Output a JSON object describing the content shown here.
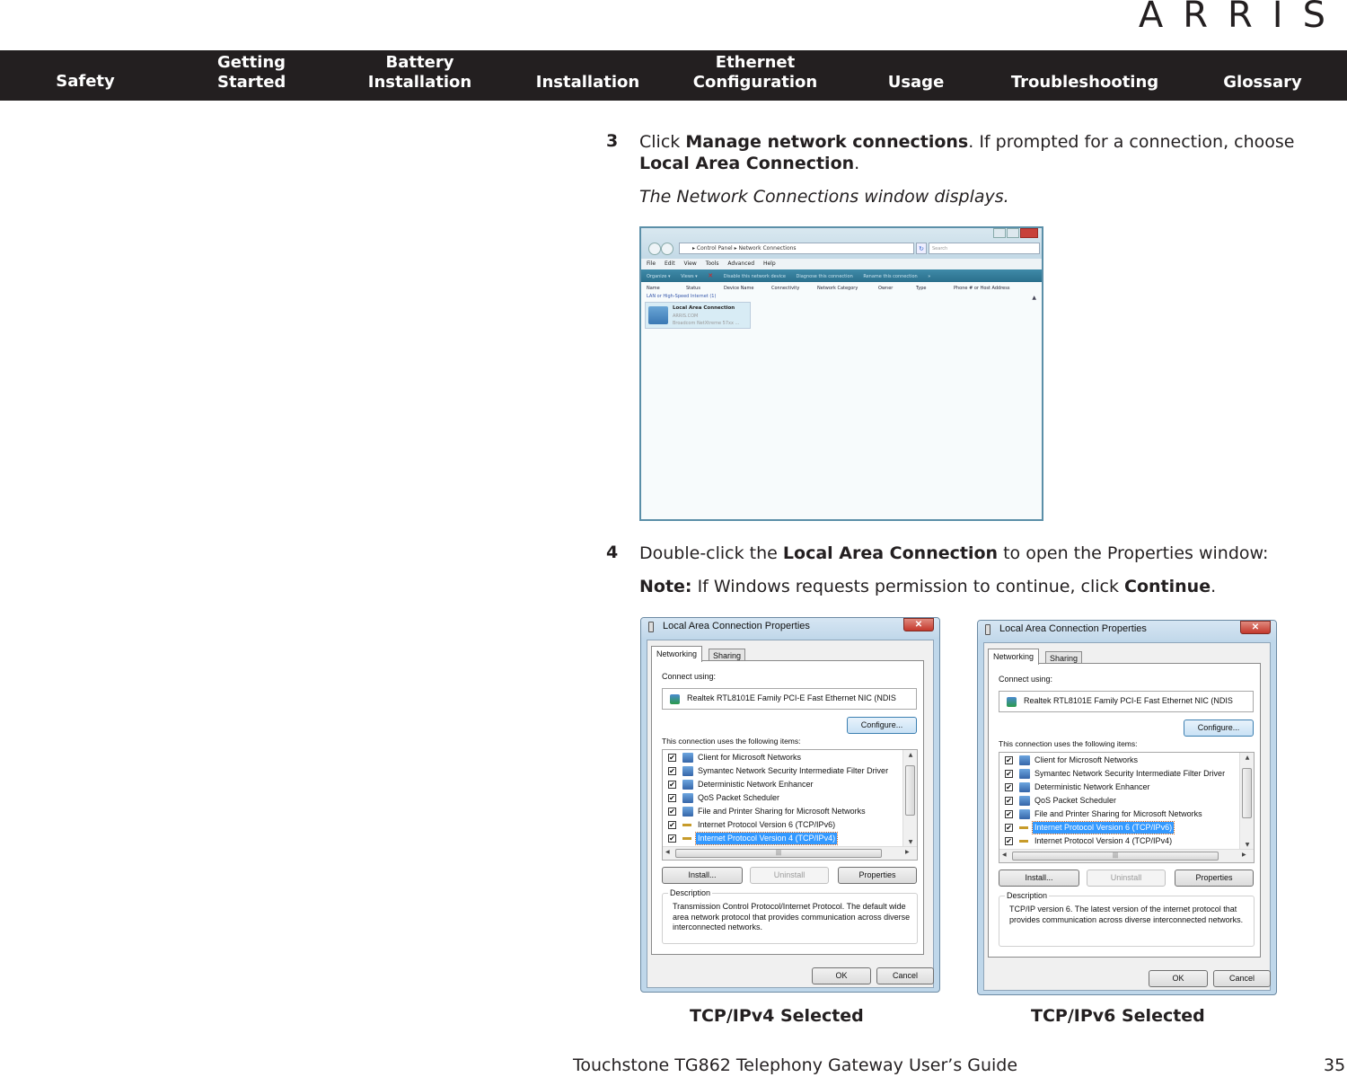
{
  "brand": {
    "logo_text": "ARRIS"
  },
  "nav": {
    "items": [
      {
        "label_line1": "",
        "label_line2": "Safety"
      },
      {
        "label_line1": "Getting",
        "label_line2": "Started"
      },
      {
        "label_line1": "Battery",
        "label_line2": "Installation"
      },
      {
        "label_line1": "",
        "label_line2": "Installation"
      },
      {
        "label_line1": "Ethernet",
        "label_line2": "Configuration"
      },
      {
        "label_line1": "",
        "label_line2": "Usage"
      },
      {
        "label_line1": "",
        "label_line2": "Troubleshooting"
      },
      {
        "label_line1": "",
        "label_line2": "Glossary"
      }
    ]
  },
  "steps": {
    "step3": {
      "number": "3",
      "text_1": "Click ",
      "bold_1": "Manage network connections",
      "text_2": ". If prompted for a connection, choose",
      "bold_2": "Local Area Connection",
      "text_3": ".",
      "result": "The Network Connections window displays."
    },
    "step4": {
      "number": "4",
      "text_1": "Double-click the ",
      "bold_1": "Local Area Connection",
      "text_2": " to open the Properties window:",
      "note_label": "Note:",
      "note_text": " If Windows requests permission to continue, click ",
      "note_bold": "Continue",
      "note_end": "."
    }
  },
  "network_connections_window": {
    "address_path": "▸ Control Panel ▸ Network Connections",
    "search_placeholder": "Search",
    "menu": [
      "File",
      "Edit",
      "View",
      "Tools",
      "Advanced",
      "Help"
    ],
    "toolbar": [
      "Organize ▾",
      "Views ▾",
      "Disable this network device",
      "Diagnose this connection",
      "Rename this connection",
      "»"
    ],
    "columns": [
      "Name",
      "Status",
      "Device Name",
      "Connectivity",
      "Network Category",
      "Owner",
      "Type",
      "Phone # or Host Address"
    ],
    "group_label": "LAN or High-Speed Internet (1)",
    "connection": {
      "name": "Local Area Connection",
      "network": "ARRIS.COM",
      "device": "Broadcom NetXtreme 57xx ..."
    }
  },
  "properties_dialogs": [
    {
      "title": "Local Area Connection Properties",
      "close_label": "✕",
      "tabs": [
        "Networking",
        "Sharing"
      ],
      "connect_using_label": "Connect using:",
      "adapter": "Realtek RTL8101E Family PCI-E Fast Ethernet NIC (NDIS",
      "configure_label": "Configure...",
      "items_label": "This connection uses the following items:",
      "items": [
        {
          "label": "Client for Microsoft Networks",
          "checked": true,
          "icon": "network-client-icon"
        },
        {
          "label": "Symantec Network Security Intermediate Filter Driver",
          "checked": true,
          "icon": "network-service-icon"
        },
        {
          "label": "Deterministic Network Enhancer",
          "checked": true,
          "icon": "network-service-icon"
        },
        {
          "label": "QoS Packet Scheduler",
          "checked": true,
          "icon": "network-service-icon"
        },
        {
          "label": "File and Printer Sharing for Microsoft Networks",
          "checked": true,
          "icon": "network-service-icon"
        },
        {
          "label": "Internet Protocol Version 6 (TCP/IPv6)",
          "checked": true,
          "icon": "protocol-icon"
        },
        {
          "label": "Internet Protocol Version 4 (TCP/IPv4)",
          "checked": true,
          "icon": "protocol-icon"
        }
      ],
      "selected_index": 6,
      "install_label": "Install...",
      "uninstall_label": "Uninstall",
      "properties_label": "Properties",
      "description_label": "Description",
      "description": "Transmission Control Protocol/Internet Protocol. The default wide area network protocol that provides communication across diverse interconnected networks.",
      "ok_label": "OK",
      "cancel_label": "Cancel",
      "caption": "TCP/IPv4 Selected"
    },
    {
      "title": "Local Area Connection Properties",
      "close_label": "✕",
      "tabs": [
        "Networking",
        "Sharing"
      ],
      "connect_using_label": "Connect using:",
      "adapter": "Realtek RTL8101E Family PCI-E Fast Ethernet NIC (NDIS",
      "configure_label": "Configure...",
      "items_label": "This connection uses the following items:",
      "items": [
        {
          "label": "Client for Microsoft Networks",
          "checked": true,
          "icon": "network-client-icon"
        },
        {
          "label": "Symantec Network Security Intermediate Filter Driver",
          "checked": true,
          "icon": "network-service-icon"
        },
        {
          "label": "Deterministic Network Enhancer",
          "checked": true,
          "icon": "network-service-icon"
        },
        {
          "label": "QoS Packet Scheduler",
          "checked": true,
          "icon": "network-service-icon"
        },
        {
          "label": "File and Printer Sharing for Microsoft Networks",
          "checked": true,
          "icon": "network-service-icon"
        },
        {
          "label": "Internet Protocol Version 6 (TCP/IPv6)",
          "checked": true,
          "icon": "protocol-icon"
        },
        {
          "label": "Internet Protocol Version 4 (TCP/IPv4)",
          "checked": true,
          "icon": "protocol-icon"
        }
      ],
      "selected_index": 5,
      "install_label": "Install...",
      "uninstall_label": "Uninstall",
      "properties_label": "Properties",
      "description_label": "Description",
      "description": "TCP/IP version 6. The latest version of the internet protocol that provides communication across diverse interconnected networks.",
      "ok_label": "OK",
      "cancel_label": "Cancel",
      "caption": "TCP/IPv6 Selected"
    }
  ],
  "footer": {
    "title": "Touchstone TG862 Telephony Gateway User’s Guide",
    "page_number": "35"
  },
  "colors": {
    "nav_background": "#231f20",
    "text": "#231f20",
    "selection": "#3399ff"
  }
}
